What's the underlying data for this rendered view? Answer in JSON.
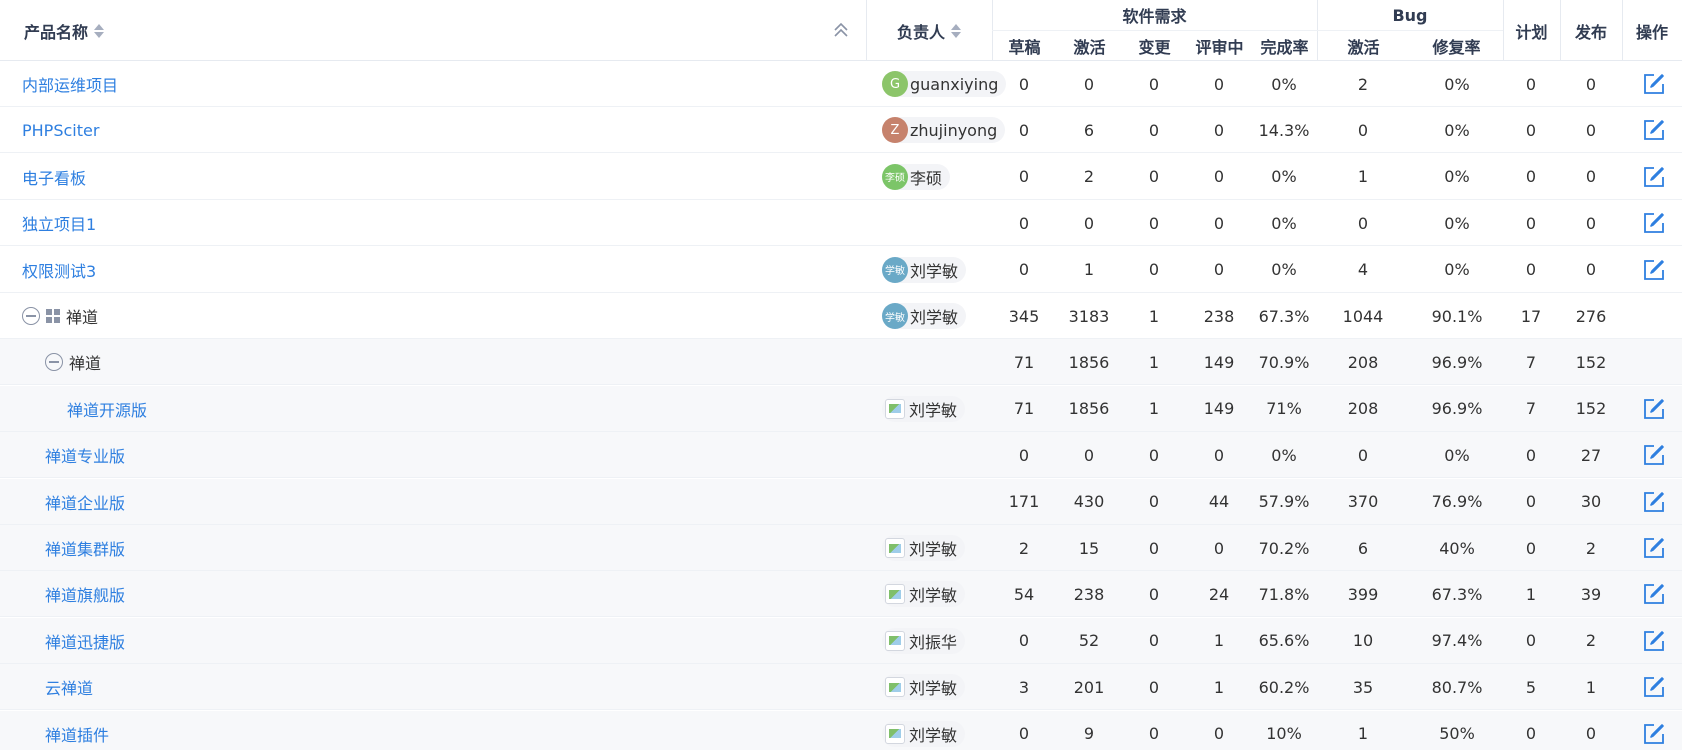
{
  "header": {
    "product_name": "产品名称",
    "owner": "负责人",
    "story_group": "软件需求",
    "story_cols": [
      "草稿",
      "激活",
      "变更",
      "评审中",
      "完成率"
    ],
    "bug_group": "Bug",
    "bug_cols": [
      "激活",
      "修复率"
    ],
    "plan": "计划",
    "release": "发布",
    "action": "操作"
  },
  "rows": [
    {
      "name": "内部运维项目",
      "level": 0,
      "link": true,
      "owner": {
        "name": "guanxiying",
        "initial": "G",
        "color": "#8cc56a",
        "type": "letter"
      },
      "values": [
        "0",
        "0",
        "0",
        "0",
        "0%",
        "2",
        "0%",
        "0",
        "0"
      ],
      "edit": true
    },
    {
      "name": "PHPSciter",
      "level": 0,
      "link": true,
      "owner": {
        "name": "zhujinyong",
        "initial": "Z",
        "color": "#c6826c",
        "type": "letter"
      },
      "values": [
        "0",
        "6",
        "0",
        "0",
        "14.3%",
        "0",
        "0%",
        "0",
        "0"
      ],
      "edit": true
    },
    {
      "name": "电子看板",
      "level": 0,
      "link": true,
      "owner": {
        "name": "李硕",
        "initial": "李硕",
        "color": "#7cc568",
        "type": "letter"
      },
      "values": [
        "0",
        "2",
        "0",
        "0",
        "0%",
        "1",
        "0%",
        "0",
        "0"
      ],
      "edit": true
    },
    {
      "name": "独立项目1",
      "level": 0,
      "link": true,
      "owner": null,
      "values": [
        "0",
        "0",
        "0",
        "0",
        "0%",
        "0",
        "0%",
        "0",
        "0"
      ],
      "edit": true
    },
    {
      "name": "权限测试3",
      "level": 0,
      "link": true,
      "owner": {
        "name": "刘学敏",
        "initial": "学敏",
        "color": "#6aa9c7",
        "type": "letter"
      },
      "values": [
        "0",
        "1",
        "0",
        "0",
        "0%",
        "4",
        "0%",
        "0",
        "0"
      ],
      "edit": true
    },
    {
      "name": "禅道",
      "level": 0,
      "link": false,
      "group": true,
      "gridicon": true,
      "owner": {
        "name": "刘学敏",
        "initial": "学敏",
        "color": "#6aa9c7",
        "type": "letter"
      },
      "values": [
        "345",
        "3183",
        "1",
        "238",
        "67.3%",
        "1044",
        "90.1%",
        "17",
        "276"
      ],
      "edit": false
    },
    {
      "name": "禅道",
      "level": 1,
      "link": false,
      "group": true,
      "sub": true,
      "owner": null,
      "values": [
        "71",
        "1856",
        "1",
        "149",
        "70.9%",
        "208",
        "96.9%",
        "7",
        "152"
      ],
      "edit": false
    },
    {
      "name": "禅道开源版",
      "level": 2,
      "link": true,
      "sub": true,
      "owner": {
        "name": "刘学敏",
        "type": "img"
      },
      "values": [
        "71",
        "1856",
        "1",
        "149",
        "71%",
        "208",
        "96.9%",
        "7",
        "152"
      ],
      "edit": true
    },
    {
      "name": "禅道专业版",
      "level": 1,
      "link": true,
      "sub": true,
      "owner": null,
      "values": [
        "0",
        "0",
        "0",
        "0",
        "0%",
        "0",
        "0%",
        "0",
        "27"
      ],
      "edit": true
    },
    {
      "name": "禅道企业版",
      "level": 1,
      "link": true,
      "sub": true,
      "owner": null,
      "values": [
        "171",
        "430",
        "0",
        "44",
        "57.9%",
        "370",
        "76.9%",
        "0",
        "30"
      ],
      "edit": true
    },
    {
      "name": "禅道集群版",
      "level": 1,
      "link": true,
      "sub": true,
      "owner": {
        "name": "刘学敏",
        "type": "img"
      },
      "values": [
        "2",
        "15",
        "0",
        "0",
        "70.2%",
        "6",
        "40%",
        "0",
        "2"
      ],
      "edit": true
    },
    {
      "name": "禅道旗舰版",
      "level": 1,
      "link": true,
      "sub": true,
      "owner": {
        "name": "刘学敏",
        "type": "img"
      },
      "values": [
        "54",
        "238",
        "0",
        "24",
        "71.8%",
        "399",
        "67.3%",
        "1",
        "39"
      ],
      "edit": true
    },
    {
      "name": "禅道迅捷版",
      "level": 1,
      "link": true,
      "sub": true,
      "owner": {
        "name": "刘振华",
        "type": "img"
      },
      "values": [
        "0",
        "52",
        "0",
        "1",
        "65.6%",
        "10",
        "97.4%",
        "0",
        "2"
      ],
      "edit": true
    },
    {
      "name": "云禅道",
      "level": 1,
      "link": true,
      "sub": true,
      "owner": {
        "name": "刘学敏",
        "type": "img"
      },
      "values": [
        "3",
        "201",
        "0",
        "1",
        "60.2%",
        "35",
        "80.7%",
        "5",
        "1"
      ],
      "edit": true
    },
    {
      "name": "禅道插件",
      "level": 1,
      "link": true,
      "sub": true,
      "owner": {
        "name": "刘学敏",
        "type": "img"
      },
      "values": [
        "0",
        "9",
        "0",
        "0",
        "10%",
        "1",
        "50%",
        "0",
        "0"
      ],
      "edit": true
    }
  ],
  "colors": {
    "link": "#2e7fe0",
    "header_text": "#313c52",
    "border": "#e6eaf0",
    "sub_row_bg": "#f7f8fa"
  },
  "icons": {
    "sort": "sort-icon",
    "collapse_all": "double-chevron-up-icon",
    "edit": "edit-icon",
    "toggle": "collapse-circle-icon",
    "group": "grid-icon"
  }
}
